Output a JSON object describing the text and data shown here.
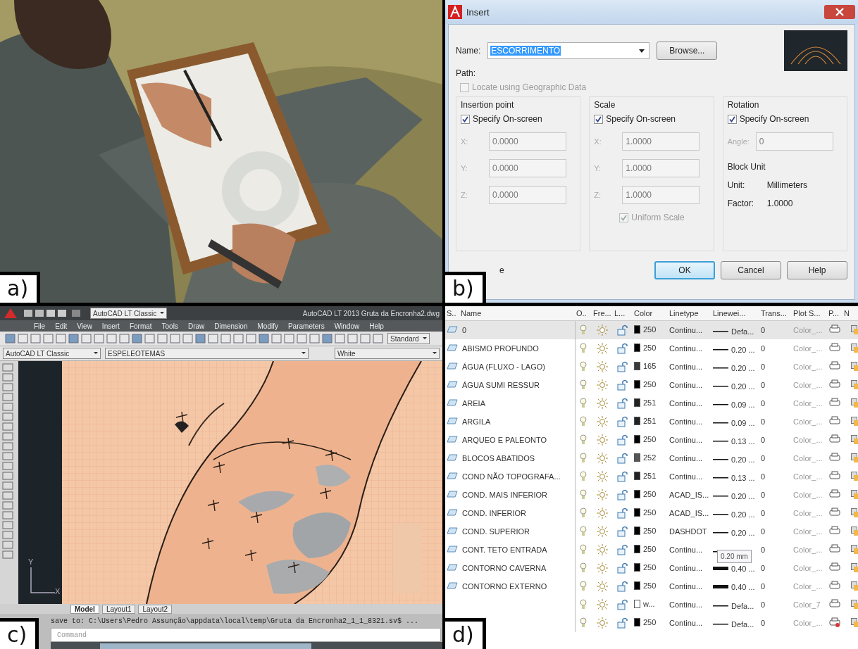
{
  "panels": {
    "a": {
      "label": "a)",
      "kind": "picture"
    },
    "b": {
      "label": "b)",
      "dialog": {
        "title": "Insert",
        "name_label": "Name:",
        "name_value": "ESCORRIMENTO",
        "browse": "Browse...",
        "path_label": "Path:",
        "geo": {
          "label": "Locate using Geographic Data",
          "checked": false,
          "disabled": true
        },
        "groups": [
          {
            "title": "Insertion point",
            "on_screen": {
              "label": "Specify On-screen",
              "checked": true
            },
            "fields": [
              {
                "label": "X:",
                "value": "0.0000"
              },
              {
                "label": "Y:",
                "value": "0.0000"
              },
              {
                "label": "Z:",
                "value": "0.0000"
              }
            ]
          },
          {
            "title": "Scale",
            "on_screen": {
              "label": "Specify On-screen",
              "checked": true
            },
            "fields": [
              {
                "label": "X:",
                "value": "1.0000"
              },
              {
                "label": "Y:",
                "value": "1.0000"
              },
              {
                "label": "Z:",
                "value": "1.0000"
              }
            ],
            "uniform": {
              "label": "Uniform Scale",
              "checked": true,
              "disabled": true
            }
          },
          {
            "title": "Rotation",
            "on_screen": {
              "label": "Specify On-screen",
              "checked": true
            },
            "fields": [
              {
                "label": "Angle:",
                "value": "0"
              }
            ],
            "block_unit": {
              "title": "Block Unit",
              "unit_label": "Unit:",
              "unit_value": "Millimeters",
              "factor_label": "Factor:",
              "factor_value": "1.0000"
            }
          }
        ],
        "explode_fragment": "e",
        "buttons": [
          {
            "label": "OK",
            "focused": true
          },
          {
            "label": "Cancel",
            "focused": false
          },
          {
            "label": "Help",
            "focused": false
          }
        ]
      }
    },
    "c": {
      "label": "c)",
      "cad": {
        "workspace": "AutoCAD LT Classic",
        "title": "AutoCAD LT 2013   Gruta da Encronha2.dwg",
        "menu": [
          "File",
          "Edit",
          "View",
          "Insert",
          "Format",
          "Tools",
          "Draw",
          "Dimension",
          "Modify",
          "Parameters",
          "Window",
          "Help"
        ],
        "text_style": "Standard",
        "workspace_2": "AutoCAD LT Classic",
        "layer": "ESPELEOTEMAS",
        "color_setting": "White",
        "ucs": {
          "y": "Y",
          "x": "X"
        },
        "tabs": [
          {
            "label": "Model",
            "selected": true
          },
          {
            "label": "Layout1",
            "selected": false
          },
          {
            "label": "Layout2",
            "selected": false
          }
        ],
        "command_history": "save to: C:\\Users\\Pedro Assunção\\appdata\\local\\temp\\Gruta da Encronha2_1_1_8321.sv$ ...",
        "command_placeholder": "Command"
      }
    },
    "d": {
      "label": "d)",
      "layers": {
        "columns": [
          "S..",
          "Name",
          "O..",
          "Fre...",
          "L...",
          "Color",
          "Linetype",
          "Linewei...",
          "Trans...",
          "Plot S...",
          "P...",
          "N"
        ],
        "tooltip": "0.20 mm",
        "rows": [
          {
            "name": "0",
            "color": "#000000",
            "aci": "250",
            "linetype": "Continu...",
            "kind": "thin",
            "lineweight": "Defa...",
            "trans": "0",
            "plot_style": "Color_...",
            "plot": true,
            "selected": true
          },
          {
            "name": "ABISMO PROFUNDO",
            "color": "#000000",
            "aci": "250",
            "linetype": "Continu...",
            "kind": "thin",
            "lineweight": "0.20 ...",
            "trans": "0",
            "plot_style": "Color_...",
            "plot": true,
            "selected": false
          },
          {
            "name": "ÁGUA (FLUXO - LAGO)",
            "color": "#3a3a3a",
            "aci": "165",
            "linetype": "Continu...",
            "kind": "thin",
            "lineweight": "0.20 ...",
            "trans": "0",
            "plot_style": "Color_...",
            "plot": true,
            "selected": false
          },
          {
            "name": "ÁGUA SUMI RESSUR",
            "color": "#000000",
            "aci": "250",
            "linetype": "Continu...",
            "kind": "thin",
            "lineweight": "0.20 ...",
            "trans": "0",
            "plot_style": "Color_...",
            "plot": true,
            "selected": false
          },
          {
            "name": "AREIA",
            "color": "#222222",
            "aci": "251",
            "linetype": "Continu...",
            "kind": "thin",
            "lineweight": "0.09 ...",
            "trans": "0",
            "plot_style": "Color_...",
            "plot": true,
            "selected": false
          },
          {
            "name": "ARGILA",
            "color": "#222222",
            "aci": "251",
            "linetype": "Continu...",
            "kind": "thin",
            "lineweight": "0.09 ...",
            "trans": "0",
            "plot_style": "Color_...",
            "plot": true,
            "selected": false
          },
          {
            "name": "ARQUEO E PALEONTO",
            "color": "#000000",
            "aci": "250",
            "linetype": "Continu...",
            "kind": "thin",
            "lineweight": "0.13 ...",
            "trans": "0",
            "plot_style": "Color_...",
            "plot": true,
            "selected": false
          },
          {
            "name": "BLOCOS ABATIDOS",
            "color": "#555555",
            "aci": "252",
            "linetype": "Continu...",
            "kind": "thin",
            "lineweight": "0.20 ...",
            "trans": "0",
            "plot_style": "Color_...",
            "plot": true,
            "selected": false
          },
          {
            "name": "COND NÃO TOPOGRAFA...",
            "color": "#222222",
            "aci": "251",
            "linetype": "Continu...",
            "kind": "thin",
            "lineweight": "0.13 ...",
            "trans": "0",
            "plot_style": "Color_...",
            "plot": true,
            "selected": false
          },
          {
            "name": "COND.  MAIS INFERIOR",
            "color": "#000000",
            "aci": "250",
            "linetype": "ACAD_IS...",
            "kind": "thin",
            "lineweight": "0.20 ...",
            "trans": "0",
            "plot_style": "Color_...",
            "plot": true,
            "selected": false
          },
          {
            "name": "COND. INFERIOR",
            "color": "#000000",
            "aci": "250",
            "linetype": "ACAD_IS...",
            "kind": "thin",
            "lineweight": "0.20 ...",
            "trans": "0",
            "plot_style": "Color_...",
            "plot": true,
            "selected": false
          },
          {
            "name": "COND. SUPERIOR",
            "color": "#000000",
            "aci": "250",
            "linetype": "DASHDOT",
            "kind": "thin",
            "lineweight": "0.20 ...",
            "trans": "0",
            "plot_style": "Color_...",
            "plot": true,
            "selected": false
          },
          {
            "name": "CONT. TETO ENTRADA",
            "color": "#000000",
            "aci": "250",
            "linetype": "Continu...",
            "kind": "thin",
            "trans": "0",
            "plot_style": "Color_...",
            "plot": true,
            "selected": false,
            "has_tooltip": true
          },
          {
            "name": "CONTORNO CAVERNA",
            "color": "#000000",
            "aci": "250",
            "linetype": "Continu...",
            "kind": "thick",
            "lineweight": "0.40 ...",
            "trans": "0",
            "plot_style": "Color_...",
            "plot": true,
            "selected": false
          },
          {
            "name": "CONTORNO EXTERNO",
            "color": "#000000",
            "aci": "250",
            "linetype": "Continu...",
            "kind": "thick",
            "lineweight": "0.40 ...",
            "trans": "0",
            "plot_style": "Color_...",
            "plot": true,
            "selected": false
          },
          {
            "color": "#ffffff",
            "aci": "w...",
            "linetype": "Continu...",
            "kind": "thin",
            "lineweight": "Defa...",
            "trans": "0",
            "plot_style": "Color_7",
            "plot": true,
            "selected": false
          },
          {
            "color": "#000000",
            "aci": "250",
            "linetype": "Continu...",
            "kind": "thin",
            "lineweight": "Defa...",
            "trans": "0",
            "plot_style": "Color_...",
            "plot": false,
            "selected": false
          }
        ]
      }
    }
  }
}
